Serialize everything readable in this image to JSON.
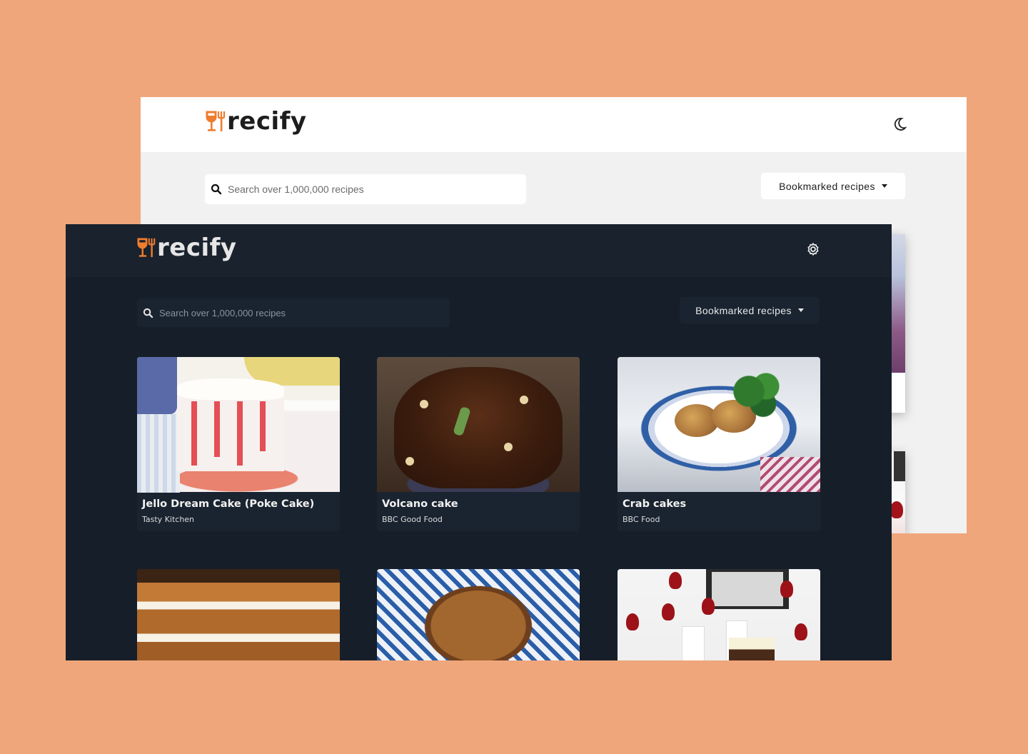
{
  "colors": {
    "background": "#f0a67b",
    "light_surface": "#f1f1f1",
    "dark_surface": "#161f29",
    "dark_card": "#1a2430",
    "accent": "#ef7d2e"
  },
  "light": {
    "logo": "recify",
    "theme_toggle_icon": "moon-icon",
    "search": {
      "placeholder": "Search over 1,000,000 recipes",
      "icon": "search-icon"
    },
    "bookmarks_label": "Bookmarked recipes"
  },
  "dark": {
    "logo": "recify",
    "settings_icon": "gear-icon",
    "search": {
      "placeholder": "Search over 1,000,000 recipes",
      "icon": "search-icon"
    },
    "bookmarks_label": "Bookmarked recipes",
    "recipes": [
      {
        "title": "Jello Dream Cake (Poke Cake)",
        "source": "Tasty Kitchen"
      },
      {
        "title": "Volcano cake",
        "source": "BBC Good Food"
      },
      {
        "title": "Crab cakes",
        "source": "BBC Food"
      },
      {
        "title": "",
        "source": ""
      },
      {
        "title": "",
        "source": ""
      },
      {
        "title": "",
        "source": ""
      }
    ]
  }
}
